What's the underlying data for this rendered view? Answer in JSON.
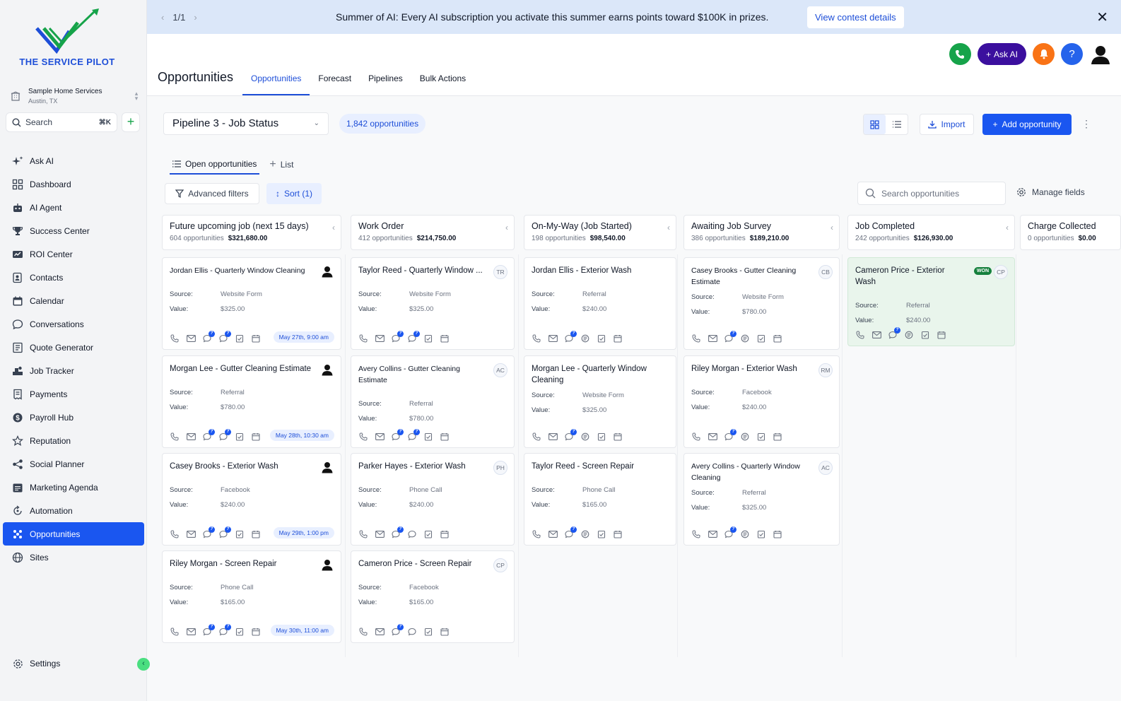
{
  "brand": {
    "name": "THE SERVICE PILOT"
  },
  "location": {
    "name": "Sample Home Services",
    "city": "Austin, TX"
  },
  "sidebar_search": {
    "label": "Search",
    "shortcut": "⌘K"
  },
  "nav": [
    {
      "label": "Ask AI",
      "icon": "sparkle-icon"
    },
    {
      "label": "Dashboard",
      "icon": "grid-icon"
    },
    {
      "label": "AI Agent",
      "icon": "robot-icon"
    },
    {
      "label": "Success Center",
      "icon": "trophy-icon"
    },
    {
      "label": "ROI Center",
      "icon": "roi-icon"
    },
    {
      "label": "Contacts",
      "icon": "contacts-icon"
    },
    {
      "label": "Calendar",
      "icon": "calendar-icon"
    },
    {
      "label": "Conversations",
      "icon": "chat-icon"
    },
    {
      "label": "Quote Generator",
      "icon": "quote-icon"
    },
    {
      "label": "Job Tracker",
      "icon": "tracker-icon"
    },
    {
      "label": "Payments",
      "icon": "receipt-icon"
    },
    {
      "label": "Payroll Hub",
      "icon": "dollar-icon"
    },
    {
      "label": "Reputation",
      "icon": "star-icon"
    },
    {
      "label": "Social Planner",
      "icon": "share-icon"
    },
    {
      "label": "Marketing Agenda",
      "icon": "agenda-icon"
    },
    {
      "label": "Automation",
      "icon": "automation-icon"
    },
    {
      "label": "Opportunities",
      "icon": "opportunities-icon",
      "active": true
    },
    {
      "label": "Sites",
      "icon": "globe-icon"
    }
  ],
  "settings": {
    "label": "Settings"
  },
  "banner": {
    "pager": "1/1",
    "message": "Summer of AI: Every AI subscription you activate this summer earns points toward $100K in prizes.",
    "cta": "View contest details"
  },
  "header": {
    "title": "Opportunities",
    "tabs": [
      "Opportunities",
      "Forecast",
      "Pipelines",
      "Bulk Actions"
    ],
    "ask_ai": "Ask AI"
  },
  "toolbar": {
    "pipeline": "Pipeline 3 - Job Status",
    "count": "1,842 opportunities",
    "import": "Import",
    "add": "Add opportunity",
    "subtabs": [
      "Open opportunities",
      "List"
    ],
    "filters": "Advanced filters",
    "sort": "Sort (1)",
    "search_placeholder": "Search opportunities",
    "manage": "Manage fields"
  },
  "card_labels": {
    "source": "Source:",
    "value": "Value:"
  },
  "columns": [
    {
      "title": "Future upcoming job (next 15 days)",
      "count": "604 opportunities",
      "total": "$321,680.00",
      "cards": [
        {
          "title": "Jordan Ellis - Quarterly Window Cleaning",
          "source": "Website Form",
          "value": "$325.00",
          "tag": "person",
          "date": "May 27th, 9:00 am"
        },
        {
          "title": "Morgan Lee - Gutter Cleaning Estimate",
          "source": "Referral",
          "value": "$780.00",
          "tag": "person",
          "date": "May 28th, 10:30 am"
        },
        {
          "title": "Casey Brooks - Exterior Wash",
          "source": "Facebook",
          "value": "$240.00",
          "tag": "person",
          "date": "May 29th, 1:00 pm"
        },
        {
          "title": "Riley Morgan - Screen Repair",
          "source": "Phone Call",
          "value": "$165.00",
          "tag": "person",
          "date": "May 30th, 11:00 am"
        }
      ]
    },
    {
      "title": "Work Order",
      "count": "412 opportunities",
      "total": "$214,750.00",
      "cards": [
        {
          "title": "Taylor Reed - Quarterly Window ...",
          "source": "Website Form",
          "value": "$325.00",
          "tag": "TR"
        },
        {
          "title": "Avery Collins - Gutter Cleaning Estimate",
          "source": "Referral",
          "value": "$780.00",
          "tag": "AC"
        },
        {
          "title": "Parker Hayes - Exterior Wash",
          "source": "Phone Call",
          "value": "$240.00",
          "tag": "PH"
        },
        {
          "title": "Cameron Price - Screen Repair",
          "source": "Facebook",
          "value": "$165.00",
          "tag": "CP"
        }
      ]
    },
    {
      "title": "On-My-Way (Job Started)",
      "count": "198 opportunities",
      "total": "$98,540.00",
      "cards": [
        {
          "title": "Jordan Ellis - Exterior Wash",
          "source": "Referral",
          "value": "$240.00"
        },
        {
          "title": "Morgan Lee - Quarterly Window Cleaning",
          "source": "Website Form",
          "value": "$325.00"
        },
        {
          "title": "Taylor Reed - Screen Repair",
          "source": "Phone Call",
          "value": "$165.00"
        }
      ]
    },
    {
      "title": "Awaiting Job Survey",
      "count": "386 opportunities",
      "total": "$189,210.00",
      "cards": [
        {
          "title": "Casey Brooks - Gutter Cleaning Estimate",
          "source": "Website Form",
          "value": "$780.00",
          "tag": "CB"
        },
        {
          "title": "Riley Morgan - Exterior Wash",
          "source": "Facebook",
          "value": "$240.00",
          "tag": "RM"
        },
        {
          "title": "Avery Collins - Quarterly Window Cleaning",
          "source": "Referral",
          "value": "$325.00",
          "tag": "AC"
        }
      ]
    },
    {
      "title": "Job Completed",
      "count": "242 opportunities",
      "total": "$126,930.00",
      "cards": [
        {
          "title": "Cameron Price - Exterior Wash",
          "source": "Referral",
          "value": "$240.00",
          "tag": "CP",
          "badge": "WON"
        }
      ]
    },
    {
      "title": "Charge Collected",
      "count": "0 opportunities",
      "total": "$0.00",
      "cards": []
    }
  ],
  "colors": {
    "primary": "#1a56f0",
    "banner": "#dbe7f9",
    "won": "#15803d",
    "call": "#16a34a",
    "bell": "#f97316",
    "help": "#2563eb",
    "ask_ai": "#3b0f9e"
  }
}
